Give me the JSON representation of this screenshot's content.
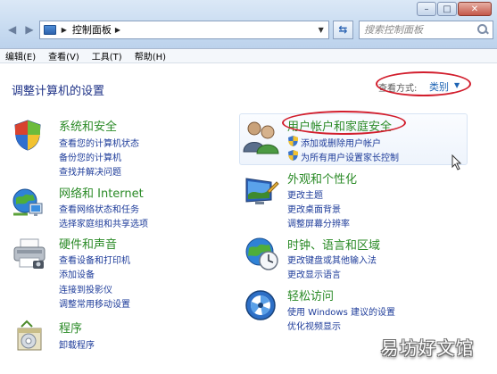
{
  "window": {
    "min_label": "–",
    "max_label": "□",
    "close_label": "✕"
  },
  "address": {
    "path": "控制面板",
    "search_placeholder": "搜索控制面板"
  },
  "menubar": {
    "items": [
      "编辑(E)",
      "查看(V)",
      "工具(T)",
      "帮助(H)"
    ]
  },
  "content": {
    "heading": "调整计算机的设置",
    "view_by_label": "查看方式:",
    "view_by_value": "类别"
  },
  "categories": {
    "system": {
      "title": "系统和安全",
      "icon": "shield-flag-icon",
      "links": [
        "查看您的计算机状态",
        "备份您的计算机",
        "查找并解决问题"
      ]
    },
    "network": {
      "title": "网络和 Internet",
      "icon": "network-globe-icon",
      "links": [
        "查看网络状态和任务",
        "选择家庭组和共享选项"
      ]
    },
    "hardware": {
      "title": "硬件和声音",
      "icon": "printer-icon",
      "links": [
        "查看设备和打印机",
        "添加设备",
        "连接到投影仪",
        "调整常用移动设置"
      ]
    },
    "programs": {
      "title": "程序",
      "icon": "programs-icon",
      "links": [
        "卸载程序"
      ]
    },
    "users": {
      "title": "用户帐户和家庭安全",
      "icon": "users-icon",
      "links": [
        "添加或删除用户帐户",
        "为所有用户设置家长控制"
      ]
    },
    "appearance": {
      "title": "外观和个性化",
      "icon": "monitor-icon",
      "links": [
        "更改主题",
        "更改桌面背景",
        "调整屏幕分辨率"
      ]
    },
    "clock": {
      "title": "时钟、语言和区域",
      "icon": "clock-globe-icon",
      "links": [
        "更改键盘或其他输入法",
        "更改显示语言"
      ]
    },
    "ease": {
      "title": "轻松访问",
      "icon": "ease-of-access-icon",
      "links": [
        "使用 Windows 建议的设置",
        "优化视频显示"
      ]
    }
  },
  "watermark": "易坊好文馆",
  "colors": {
    "category_title": "#2a8a26",
    "link": "#1e3c9a",
    "annotation": "#d21e2d"
  }
}
